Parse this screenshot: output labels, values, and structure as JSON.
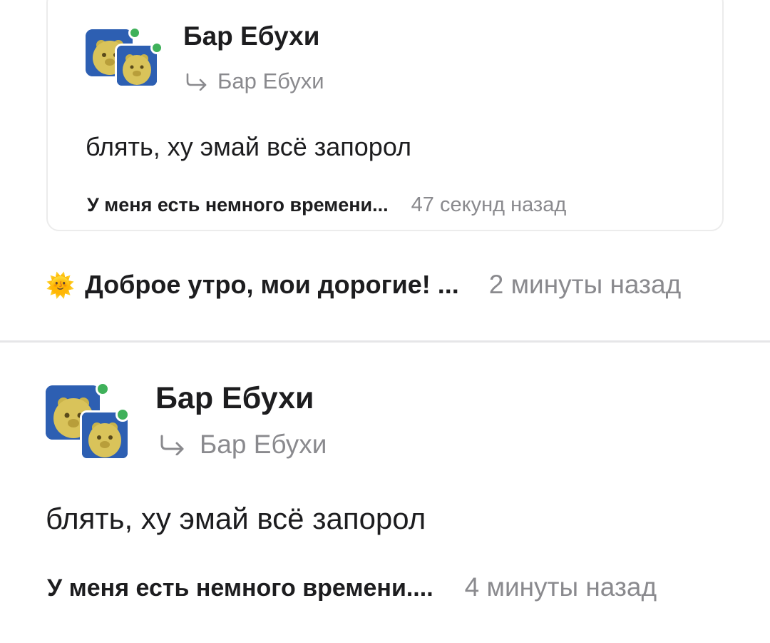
{
  "card": {
    "author": "Бар Ебухи",
    "reply_to": "Бар Ебухи",
    "message": "блять, ху эмай всё запорол",
    "thread_title": "У меня есть немного времени...",
    "time": "47 секунд назад"
  },
  "standalone_thread": {
    "emoji": "🌞",
    "title": "Доброе утро, мои дорогие! ...",
    "time": "2 минуты назад"
  },
  "post": {
    "author": "Бар Ебухи",
    "reply_to": "Бар Ебухи",
    "message": "блять, ху эмай всё запорол",
    "thread_title": "У меня есть немного времени....",
    "time": "4 минуты назад"
  },
  "colors": {
    "online": "#3fb15a",
    "avatar_bg": "#2d5fb2",
    "muted": "#8a8a8e",
    "divider": "#e6e6e8"
  }
}
